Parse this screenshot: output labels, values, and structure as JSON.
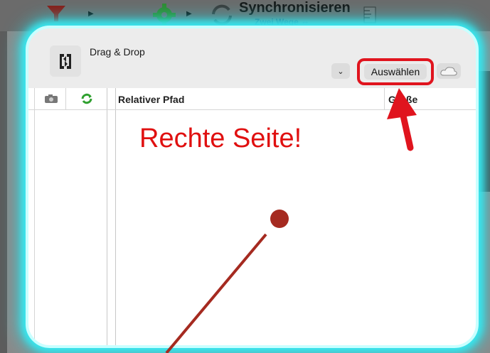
{
  "toolbar": {
    "sync_title": "Synchronisieren",
    "sync_subtitle": "Zwei Wege ⇔",
    "icons": [
      "filter-icon",
      "gear-icon",
      "sync-icon",
      "ruler-icon"
    ]
  },
  "panel": {
    "dragdrop_label": "Drag & Drop",
    "dropdown_icon": "chevron-down-icon",
    "select_button_label": "Auswählen",
    "cloud_icon": "cloud-icon",
    "columns": {
      "relative_path": "Relativer Pfad",
      "size": "Größe"
    }
  },
  "annotation": {
    "text": "Rechte Seite!",
    "color": "#e01010",
    "highlight_color": "#e0141e",
    "glow_color": "#38e8f0"
  }
}
